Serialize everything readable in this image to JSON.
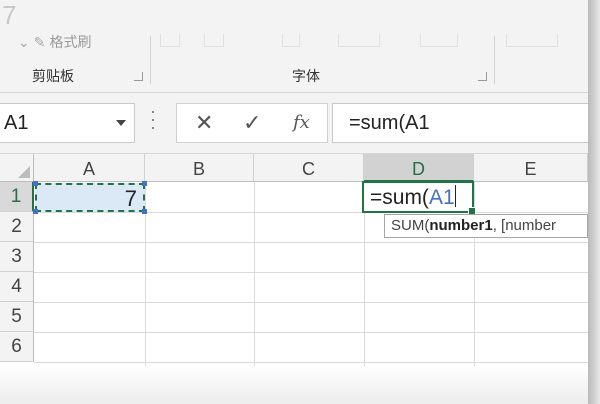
{
  "ribbon": {
    "faded_digit": "7",
    "format_painter_label": "格式刷",
    "groups": [
      {
        "name": "clipboard",
        "label": "剪贴板"
      },
      {
        "name": "font",
        "label": "字体"
      }
    ]
  },
  "formula_bar": {
    "name_box_value": "A1",
    "cancel_symbol": "✕",
    "enter_symbol": "✓",
    "function_symbol": "fx",
    "formula_value": "=sum(A1"
  },
  "sheet": {
    "columns": [
      "A",
      "B",
      "C",
      "D",
      "E"
    ],
    "rows": [
      "1",
      "2",
      "3",
      "4",
      "5",
      "6"
    ],
    "active_column": "D",
    "active_row": "1",
    "cells": {
      "A1": "7",
      "D1_prefix": "=sum(",
      "D1_ref": "A1"
    },
    "tooltip": {
      "func": "SUM(",
      "arg1": "number1",
      "rest": ", [number"
    }
  },
  "colors": {
    "accent": "#217346",
    "reference": "#4472c4",
    "selection_fill": "#dbe8f6"
  }
}
